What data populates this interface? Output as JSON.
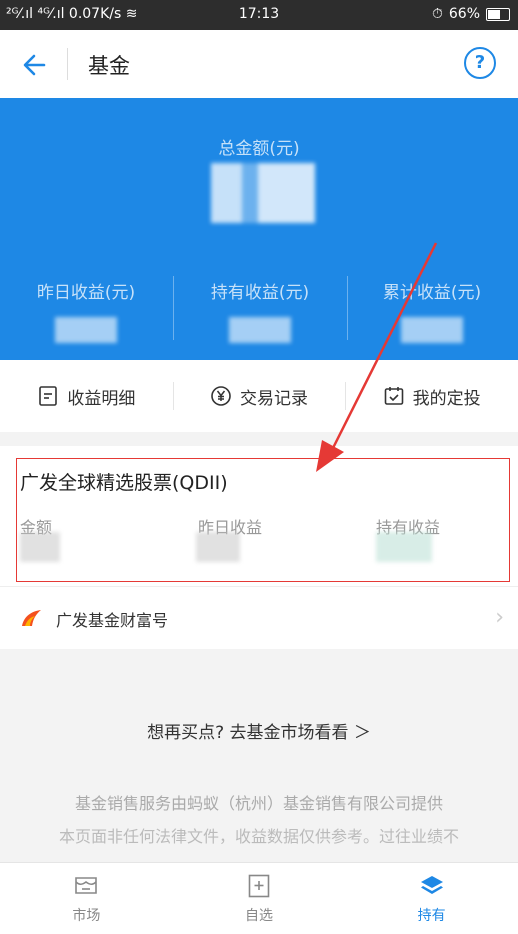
{
  "status_bar": {
    "signal": "²ᴳ⁄.ıl ⁴ᴳ⁄.ıl 0.07K/s ≋",
    "time": "17:13",
    "alarm": "⏱",
    "battery": "66%"
  },
  "nav": {
    "title": "基金",
    "help": "?"
  },
  "summary": {
    "total_label": "总金额(元)",
    "yesterday_label": "昨日收益(元)",
    "holding_label": "持有收益(元)",
    "cumulative_label": "累计收益(元)"
  },
  "actions": [
    {
      "label": "收益明细",
      "icon": "receipt-icon"
    },
    {
      "label": "交易记录",
      "icon": "yen-circle-icon"
    },
    {
      "label": "我的定投",
      "icon": "calendar-check-icon"
    }
  ],
  "fund": {
    "name": "广发全球精选股票(QDII)",
    "col_amount": "金额",
    "col_yesterday": "昨日收益",
    "col_holding": "持有收益"
  },
  "fund_company": {
    "name": "广发基金财富号",
    "icon": "guangfa-logo-icon"
  },
  "more_link": "想再买点? 去基金市场看看 ＞",
  "footer": {
    "line1": "基金销售服务由蚂蚁（杭州）基金销售有限公司提供",
    "line2": "本页面非任何法律文件，收益数据仅供参考。过往业绩不"
  },
  "tabs": [
    {
      "label": "市场",
      "icon": "market-icon",
      "active": false
    },
    {
      "label": "自选",
      "icon": "watchlist-icon",
      "active": false
    },
    {
      "label": "持有",
      "icon": "layers-icon",
      "active": true
    }
  ],
  "colors": {
    "brand_blue": "#1e88e5",
    "annotation_red": "#e53935"
  }
}
